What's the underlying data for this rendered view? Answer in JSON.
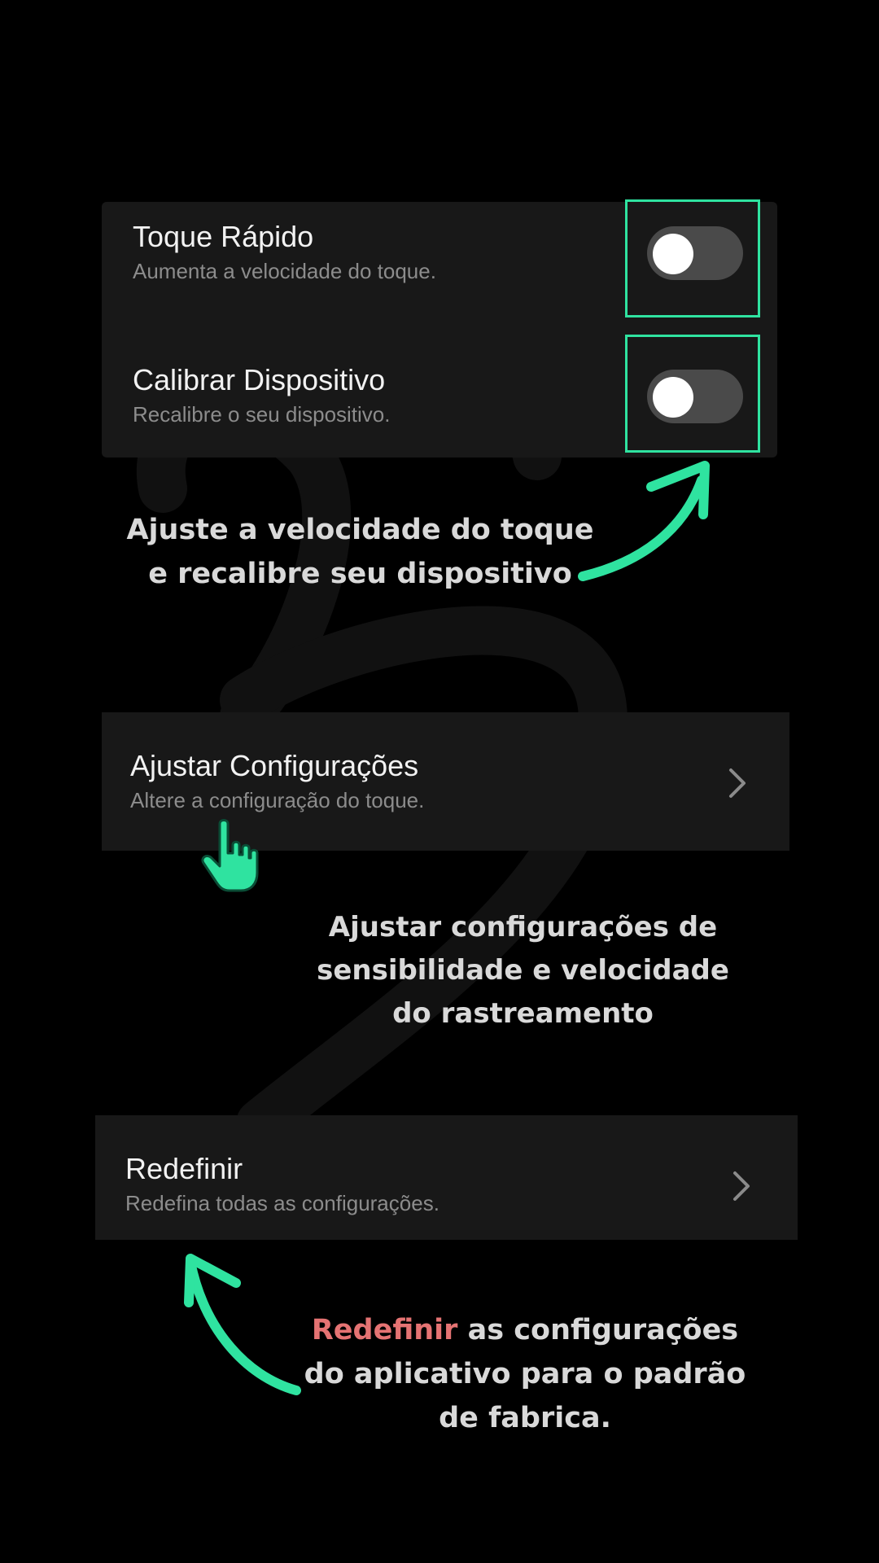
{
  "settings": {
    "fast_touch": {
      "title": "Toque Rápido",
      "subtitle": "Aumenta a velocidade do toque."
    },
    "calibrate": {
      "title": "Calibrar Dispositivo",
      "subtitle": "Recalibre o seu dispositivo."
    },
    "adjust": {
      "title": "Ajustar Configurações",
      "subtitle": "Altere a configuração do toque."
    },
    "reset": {
      "title": "Redefinir",
      "subtitle": "Redefina todas as configurações."
    }
  },
  "captions": {
    "toggles": {
      "line1": "Ajuste a velocidade do toque",
      "line2": "e recalibre seu dispositivo"
    },
    "adjust": {
      "line1": "Ajustar configurações de",
      "line2": "sensibilidade e velocidade",
      "line3": "do rastreamento"
    },
    "reset": {
      "highlight": "Redefinir",
      "line1_rest": " as configurações",
      "line2": "do aplicativo para o padrão",
      "line3": "de fabrica."
    }
  },
  "toggles": {
    "fast_touch_on": false,
    "calibrate_on": false
  },
  "icons": {
    "chevron": "chevron-right-icon",
    "pointer": "hand-pointer-icon",
    "arrow": "curved-arrow-icon"
  },
  "colors": {
    "accent": "#2fe3a0",
    "reset_highlight": "#e57373",
    "card": "#181818",
    "background": "#000000"
  }
}
